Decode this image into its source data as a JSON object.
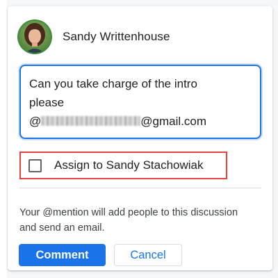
{
  "comment_card": {
    "author_name": "Sandy Writtenhouse",
    "avatar_icon": "user-photo-avatar",
    "comment_text": {
      "line1": "Can you take charge of the intro",
      "line2": "please",
      "email_prefix": "@",
      "email_suffix": "@gmail.com"
    },
    "assign_checkbox": {
      "label": "Assign to Sandy Stachowiak",
      "checked": false
    },
    "mention_note": "Your @mention will add people to this discussion and send an email.",
    "buttons": {
      "comment": "Comment",
      "cancel": "Cancel"
    }
  },
  "colors": {
    "accent": "#1a73e8",
    "highlight_border": "#e0443e",
    "text": "#202124"
  }
}
